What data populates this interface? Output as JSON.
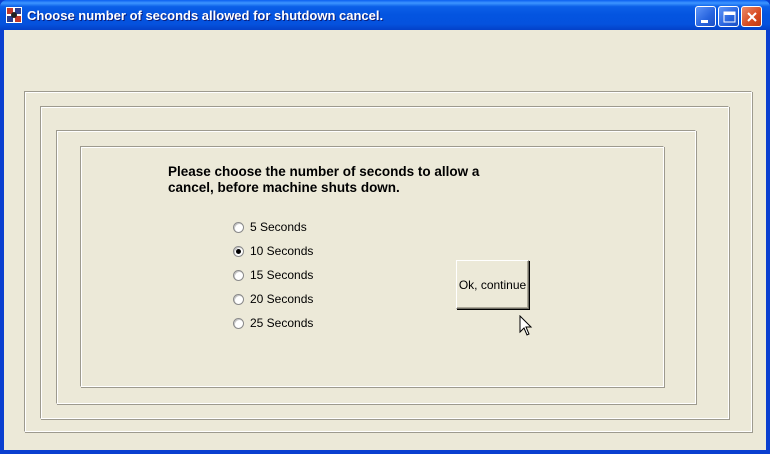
{
  "window": {
    "title": "Choose number of seconds allowed for shutdown cancel."
  },
  "prompt": {
    "line1": "Please choose the number of seconds to allow a",
    "line2": "cancel, before machine shuts down."
  },
  "options": [
    {
      "label": "5 Seconds",
      "selected": false
    },
    {
      "label": "10 Seconds",
      "selected": true
    },
    {
      "label": "15 Seconds",
      "selected": false
    },
    {
      "label": "20 Seconds",
      "selected": false
    },
    {
      "label": "25 Seconds",
      "selected": false
    }
  ],
  "ok_button": {
    "label": "Ok, continue"
  },
  "icons": {
    "app": "app-icon",
    "minimize": "minimize-icon",
    "maximize": "maximize-icon",
    "close": "close-icon",
    "cursor": "mouse-pointer-icon"
  },
  "colors": {
    "titlebar": "#0454e0",
    "window_background": "#ece9d8",
    "close_button": "#d74a20"
  }
}
